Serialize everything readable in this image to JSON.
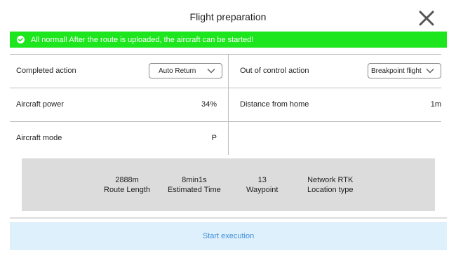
{
  "header": {
    "title": "Flight preparation",
    "close_icon": "close-icon"
  },
  "banner": {
    "text": "All normal! After the route is uploaded, the aircraft can be started!",
    "icon": "check-circle-icon",
    "color": "#1ee61e"
  },
  "settings": {
    "completed_action": {
      "label": "Completed action",
      "value": "Auto Return"
    },
    "out_of_control_action": {
      "label": "Out of control action",
      "value": "Breakpoint flight"
    },
    "aircraft_power": {
      "label": "Aircraft power",
      "value": "34%"
    },
    "distance_from_home": {
      "label": "Distance from home",
      "value": "1m"
    },
    "aircraft_mode": {
      "label": "Aircraft mode",
      "value": "P"
    }
  },
  "stats": [
    {
      "value": "2888m",
      "label": "Route Length"
    },
    {
      "value": "8min1s",
      "label": "Estimated Time"
    },
    {
      "value": "13",
      "label": "Waypoint"
    },
    {
      "value": "Network RTK",
      "label": "Location type"
    }
  ],
  "footer": {
    "start_label": "Start execution",
    "accent": "#3d8ed6"
  }
}
